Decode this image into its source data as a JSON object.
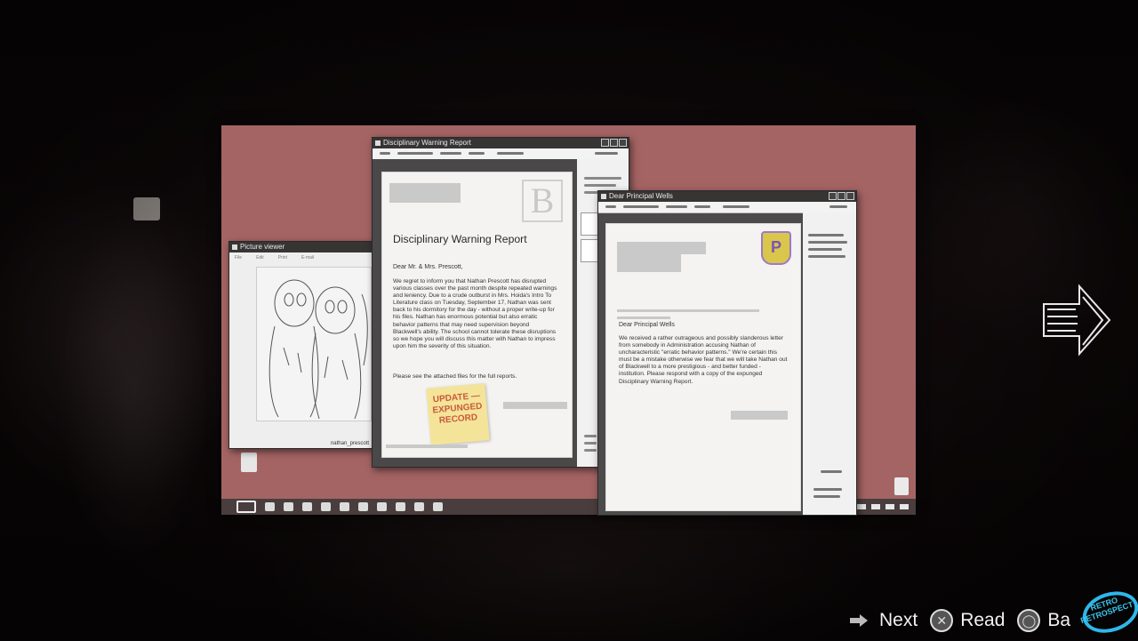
{
  "picture_viewer": {
    "title": "Picture viewer",
    "menu": [
      "File",
      "Edit",
      "Print",
      "E-mail"
    ],
    "caption": "nathan_prescott"
  },
  "report_window": {
    "title": "Disciplinary Warning Report",
    "crest_letter": "B",
    "heading": "Disciplinary Warning Report",
    "salutation": "Dear Mr. & Mrs. Prescott,",
    "body": "We regret to inform you that Nathan Prescott has disrupted various classes over the past month despite repeated warnings and leniency. Due to a crude outburst in Mrs. Hoida's Intro To Literature class on Tuesday, September 17, Nathan was sent back to his dormitory for the day - without a proper write-up for his files. Nathan has enormous potential but also erratic behavior patterns that may need supervision beyond Blackwell's ability. The school cannot tolerate these disruptions so we hope you will discuss this matter with Nathan to impress upon him the severity of this situation.",
    "footer": "Please see the attached files for the full reports.",
    "sticky_note": [
      "UPDATE —",
      "EXPUNGED",
      "RECORD"
    ]
  },
  "letter_window": {
    "title": "Dear Principal Wells",
    "crest_letter": "P",
    "salutation": "Dear Principal Wells",
    "body": "We received a rather outrageous and possibly slanderous letter from somebody in Administration accusing Nathan of uncharacteristic \"erratic behavior patterns.\" We're certain this must be a mistake otherwise we fear that we will take Nathan out of Blackwell to a more prestigious - and better funded - institution. Please respond with a copy of the expunged Disciplinary Warning Report."
  },
  "hints": {
    "next": "Next",
    "read": "Read",
    "back": "Ba"
  },
  "watermark": {
    "line1": "RETRO",
    "line2": "RETROSPECT"
  },
  "colors": {
    "desktop": "#a56464",
    "sticky_text": "#c95a3a",
    "sticky_bg": "#f4e49a",
    "watermark": "#2fb7ea"
  },
  "icons": [
    "start-menu-icon",
    "file-icon",
    "trash-icon",
    "next-arrow-icon",
    "cross-button-icon",
    "circle-button-icon"
  ]
}
